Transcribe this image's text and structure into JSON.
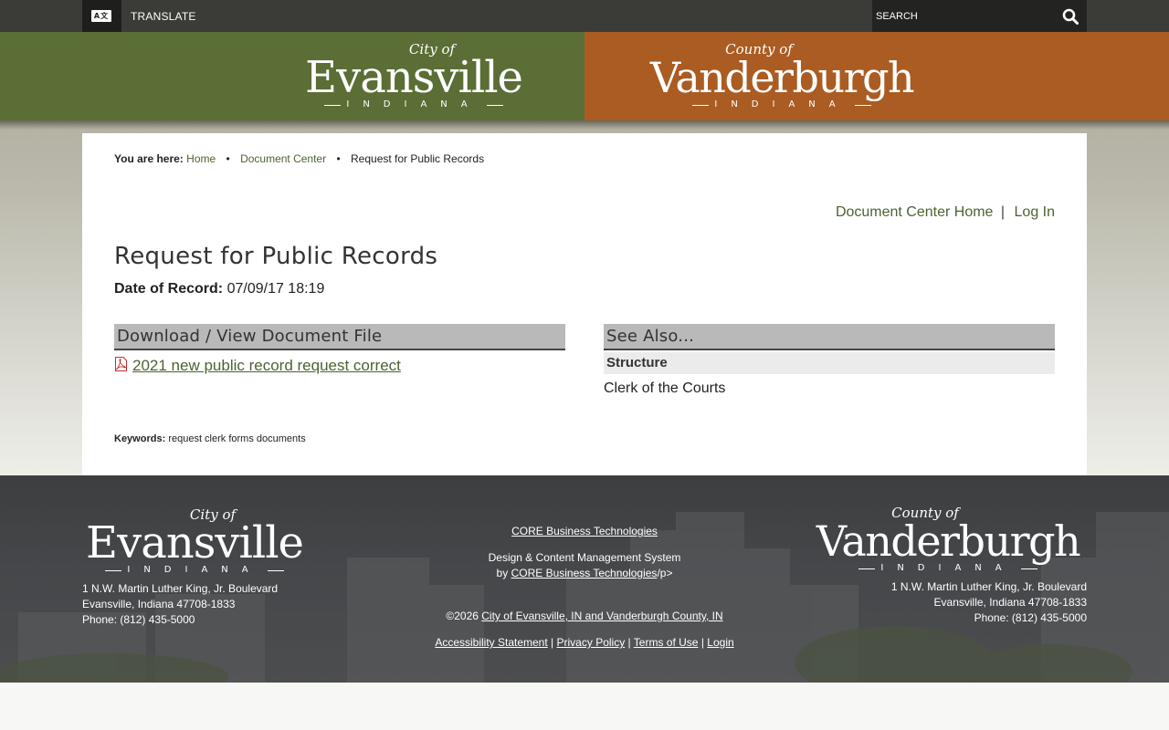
{
  "topbar": {
    "translate_label": "TRANSLATE",
    "translate_icon": "translate-icon",
    "search_placeholder": "SEARCH",
    "search_icon": "search-icon"
  },
  "banner": {
    "city": {
      "prefix": "City of",
      "name": "Evansville",
      "state": "INDIANA"
    },
    "county": {
      "prefix": "County of",
      "name": "Vanderburgh",
      "state": "INDIANA"
    },
    "colors": {
      "city_bg": "#5a6e35",
      "county_bg": "#aa5c22"
    }
  },
  "breadcrumb": {
    "label": "You are here:",
    "items": [
      "Home",
      "Document Center",
      "Request for Public Records"
    ]
  },
  "doc_links": {
    "home": "Document Center Home",
    "separator": "|",
    "login": "Log In"
  },
  "page": {
    "title": "Request for Public Records",
    "date_label": "Date of Record:",
    "date_value": "07/09/17 18:19"
  },
  "download": {
    "heading": "Download / View Document File",
    "file_icon": "pdf-icon",
    "file_name": "2021 new public record request correct"
  },
  "see_also": {
    "heading": "See Also...",
    "category": "Structure",
    "items": [
      "Clerk of the Courts"
    ]
  },
  "keywords": {
    "label": "Keywords:",
    "value": "request clerk forms documents"
  },
  "footer": {
    "left": {
      "logo_prefix": "City of",
      "logo_name": "Evansville",
      "logo_state": "INDIANA",
      "address1": "1 N.W. Martin Luther King, Jr. Boulevard",
      "address2": "Evansville, Indiana 47708-1833",
      "phone": "Phone: (812) 435-5000"
    },
    "center": {
      "vendor_link": "CORE Business Technologies",
      "cms_line": "Design & Content Management System",
      "by": "by",
      "by_link": "CORE Business Technologies",
      "by_suffix": "/p>",
      "copyright": "©2026",
      "copyright_link": "City of Evansville, IN and Vanderburgh County, IN",
      "links": [
        "Accessibility Statement",
        "Privacy Policy",
        "Terms of Use",
        "Login"
      ],
      "separator": "|"
    },
    "right": {
      "logo_prefix": "County of",
      "logo_name": "Vanderburgh",
      "logo_state": "INDIANA",
      "address1": "1 N.W. Martin Luther King, Jr. Boulevard",
      "address2": "Evansville, Indiana 47708-1833",
      "phone": "Phone: (812) 435-5000"
    }
  }
}
